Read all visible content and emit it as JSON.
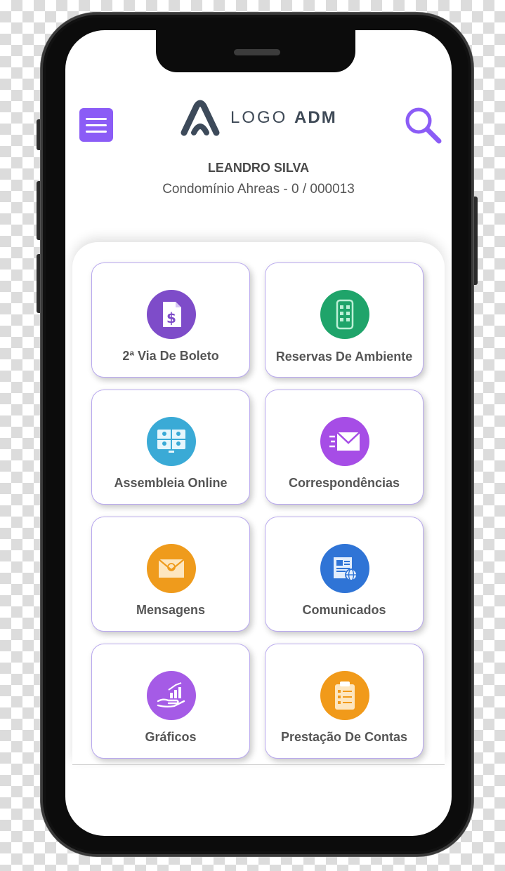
{
  "header": {
    "logo_light": "LOGO",
    "logo_bold": "ADM"
  },
  "user": {
    "name": "LEANDRO SILVA",
    "condo": "Condomínio Ahreas - 0 / 000013"
  },
  "tiles": [
    {
      "label": "2ª Via De Boleto",
      "icon": "invoice-icon",
      "color": "#7e4cc9"
    },
    {
      "label": "Reservas De Ambiente",
      "icon": "calendar-phone-icon",
      "color": "#1fa46a"
    },
    {
      "label": "Assembleia Online",
      "icon": "video-meeting-icon",
      "color": "#3aaad6"
    },
    {
      "label": "Correspondências",
      "icon": "envelope-icon",
      "color": "#a64de6"
    },
    {
      "label": "Mensagens",
      "icon": "message-envelope-icon",
      "color": "#ef9b1c"
    },
    {
      "label": "Comunicados",
      "icon": "newspaper-globe-icon",
      "color": "#2f74d6"
    },
    {
      "label": "Gráficos",
      "icon": "chart-hand-icon",
      "color": "#a55be6"
    },
    {
      "label": "Prestação De Contas",
      "icon": "clipboard-list-icon",
      "color": "#f19a1a"
    }
  ],
  "colors": {
    "accent": "#8b5cf6",
    "tile_border": "#b9a9ee"
  }
}
